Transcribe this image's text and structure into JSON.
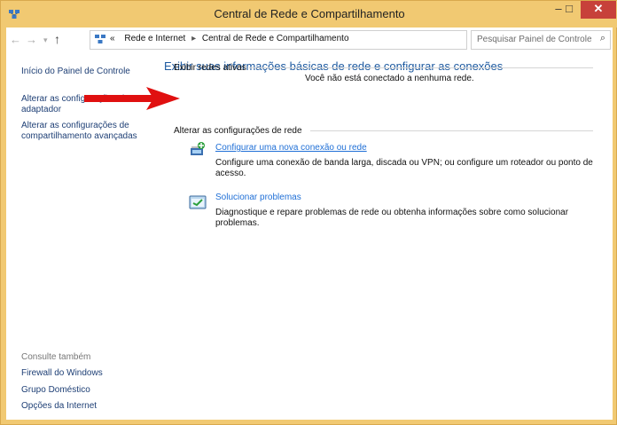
{
  "window": {
    "title": "Central de Rede e Compartilhamento",
    "controls": {
      "minimize": "–",
      "maximize": "□",
      "close": "✕"
    }
  },
  "address": {
    "back_icon": "back-arrow-icon",
    "forward_icon": "forward-arrow-icon",
    "up_icon": "up-arrow-icon",
    "prefix": "«",
    "breadcrumb": [
      "Rede e Internet",
      "Central de Rede e Compartilhamento"
    ],
    "search_placeholder": "Pesquisar Painel de Controle"
  },
  "sidebar": {
    "home": "Início do Painel de Controle",
    "adapter": "Alterar as configurações do adaptador",
    "sharing": "Alterar as configurações de compartilhamento avançadas",
    "see_also": "Consulte também",
    "firewall": "Firewall do Windows",
    "homegroup": "Grupo Doméstico",
    "internet_options": "Opções da Internet"
  },
  "main": {
    "title": "Exibir suas informações básicas de rede e configurar as conexões",
    "active_networks_label": "Exibir redes ativas",
    "not_connected": "Você não está conectado a nenhuma rede.",
    "change_settings_label": "Alterar as configurações de rede",
    "tasks": [
      {
        "icon": "network-setup-icon",
        "link": "Configurar uma nova conexão ou rede",
        "description": "Configure uma conexão de banda larga, discada ou VPN; ou configure um roteador ou ponto de acesso."
      },
      {
        "icon": "troubleshoot-icon",
        "link": "Solucionar problemas",
        "description": "Diagnostique e repare problemas de rede ou obtenha informações sobre como solucionar problemas."
      }
    ]
  },
  "colors": {
    "frame": "#f1c972",
    "close_button": "#c7413a",
    "link": "#1f6fd6",
    "title_text": "#1e5aa0",
    "annotation_arrow": "#e01010"
  }
}
